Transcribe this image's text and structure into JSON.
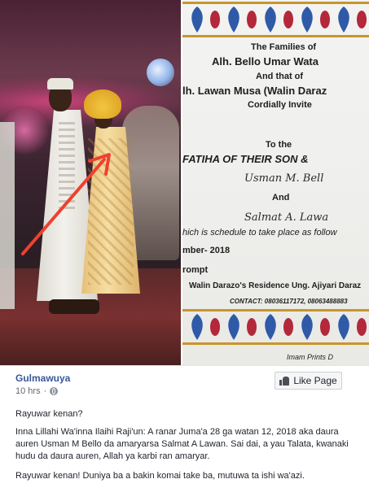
{
  "invitation": {
    "line_families": "The Families of",
    "line_host1": "Alh. Bello Umar Wata",
    "line_and_that": "And that of",
    "line_host2": "lh. Lawan Musa (Walin Daraz",
    "line_cordially": "Cordially Invite",
    "line_to_the": "To the",
    "line_fatiha": "FATIHA OF THEIR SON &",
    "line_groom": "Usman M. Bell",
    "line_and": "And",
    "line_bride": "Salmat A. Lawa",
    "line_schedule": "hich is schedule to take place as follow",
    "line_date": "mber- 2018",
    "line_prompt": "rompt",
    "line_venue": "Walin Darazo's Residence Ung. Ajiyari Daraz",
    "line_contact": "CONTACT: 08036117172, 08063488883",
    "line_printer": "Imam Prints D"
  },
  "post": {
    "page_name": "Gulmawuya",
    "time": "10 hrs",
    "like_button_label": "Like Page",
    "paragraph_1": "Rayuwar kenan?",
    "paragraph_2": "Inna Lillahi Wa'inna Ilaihi Raji'un: A ranar Juma'a 28 ga watan 12, 2018 aka daura auren Usman M Bello da amaryarsa Salmat A Lawan. Sai dai, a yau Talata, kwanaki hudu da daura auren, Allah ya karbi ran amaryar.",
    "paragraph_3": "Rayuwar kenan! Duniya ba a bakin komai take ba, mutuwa ta ishi wa'azi."
  },
  "colors": {
    "link_blue": "#385898",
    "arrow_red": "#f0402f",
    "gold_border": "#c7962c",
    "motif_blue": "#2e5aa8",
    "motif_red": "#b3283a"
  },
  "icons": {
    "meta_separator": "·",
    "like_icon": "thumbs-up-icon",
    "privacy_icon": "globe-icon"
  }
}
